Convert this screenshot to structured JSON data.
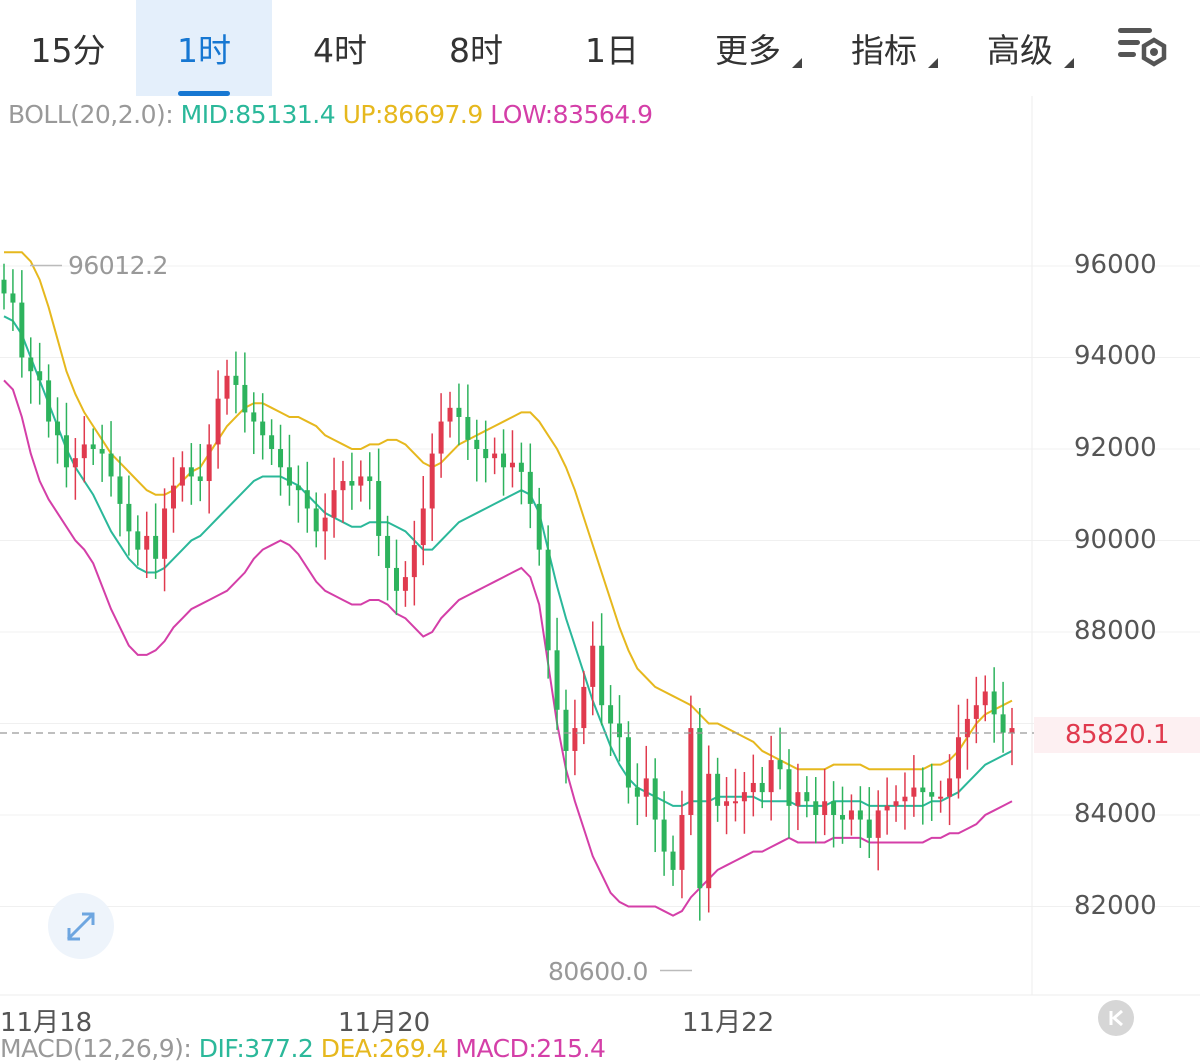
{
  "tabs": [
    {
      "label": "15分",
      "active": false,
      "dropdown": false
    },
    {
      "label": "1时",
      "active": true,
      "dropdown": false
    },
    {
      "label": "4时",
      "active": false,
      "dropdown": false
    },
    {
      "label": "8时",
      "active": false,
      "dropdown": false
    },
    {
      "label": "1日",
      "active": false,
      "dropdown": false
    },
    {
      "label": "更多",
      "active": false,
      "dropdown": true
    },
    {
      "label": "指标",
      "active": false,
      "dropdown": true
    },
    {
      "label": "高级",
      "active": false,
      "dropdown": true
    }
  ],
  "settings_icon": "chart-settings-icon",
  "boll": {
    "label": "BOLL(20,2.0):",
    "mid": "MID:85131.4",
    "up": "UP:86697.9",
    "low": "LOW:83564.9"
  },
  "annotations": {
    "high": "96012.2",
    "low": "80600.0"
  },
  "current_price": "85820.1",
  "y_axis_labels": [
    "96000",
    "94000",
    "92000",
    "90000",
    "88000",
    "84000",
    "82000"
  ],
  "x_axis_labels": [
    "11月18",
    "11月20",
    "11月22"
  ],
  "macd": {
    "label": "MACD(12,26,9):",
    "dif": "DIF:377.2",
    "dea": "DEA:269.4",
    "macd": "MACD:215.4"
  },
  "colors": {
    "up_candle": "#e03a4e",
    "down_candle": "#2db35d",
    "boll_mid": "#2bb89a",
    "boll_up": "#e6b81e",
    "boll_low": "#d43fa8",
    "active_tab": "#1677d2"
  },
  "chart_data": {
    "type": "candlestick",
    "y_ticks": [
      82000,
      84000,
      86000,
      88000,
      90000,
      92000,
      94000,
      96000
    ],
    "current": 85820.1,
    "high_marker": 96012.2,
    "low_marker": 80600.0,
    "candles_close": [
      95400,
      95200,
      94000,
      93700,
      93500,
      92600,
      92300,
      91600,
      91800,
      92100,
      92000,
      91900,
      91400,
      90800,
      90200,
      89800,
      90100,
      89600,
      90700,
      91200,
      91600,
      91400,
      91300,
      92100,
      93100,
      93600,
      93400,
      92800,
      92600,
      92300,
      92000,
      91600,
      91200,
      91100,
      90700,
      90200,
      90500,
      91100,
      91300,
      91200,
      91400,
      91300,
      90100,
      89400,
      88900,
      89200,
      89900,
      90700,
      91900,
      92600,
      92900,
      92700,
      92200,
      92000,
      91800,
      91900,
      91600,
      91700,
      91500,
      90800,
      89800,
      87600,
      86300,
      85400,
      85900,
      86800,
      87700,
      86400,
      86000,
      85700,
      84600,
      84400,
      84800,
      83900,
      83200,
      82800,
      84000,
      85900,
      82400,
      84900,
      84200,
      84300,
      84300,
      84500,
      84700,
      84500,
      85200,
      85000,
      84200,
      84500,
      84300,
      84000,
      84300,
      84000,
      83900,
      84100,
      83900,
      83500,
      84100,
      84200,
      84300,
      84400,
      84600,
      84500,
      84400,
      84400,
      84800,
      85700,
      86100,
      86400,
      86700,
      86200,
      85800,
      85900
    ],
    "boll_mid": [
      94900,
      94800,
      94500,
      94000,
      93500,
      93000,
      92500,
      92000,
      91600,
      91300,
      91000,
      90600,
      90200,
      89900,
      89600,
      89400,
      89300,
      89300,
      89400,
      89600,
      89800,
      90000,
      90100,
      90300,
      90500,
      90700,
      90900,
      91100,
      91300,
      91400,
      91400,
      91400,
      91300,
      91200,
      91000,
      90800,
      90600,
      90500,
      90400,
      90300,
      90300,
      90400,
      90400,
      90400,
      90300,
      90200,
      90000,
      89800,
      89800,
      90000,
      90200,
      90400,
      90500,
      90600,
      90700,
      90800,
      90900,
      91000,
      91100,
      91000,
      90600,
      89800,
      89000,
      88300,
      87700,
      87100,
      86500,
      86000,
      85500,
      85100,
      84800,
      84600,
      84500,
      84400,
      84300,
      84200,
      84200,
      84300,
      84300,
      84300,
      84400,
      84400,
      84400,
      84400,
      84400,
      84300,
      84300,
      84300,
      84300,
      84200,
      84200,
      84200,
      84200,
      84300,
      84300,
      84300,
      84300,
      84200,
      84200,
      84200,
      84200,
      84200,
      84200,
      84200,
      84300,
      84300,
      84400,
      84500,
      84700,
      84900,
      85100,
      85200,
      85300,
      85400
    ]
  }
}
